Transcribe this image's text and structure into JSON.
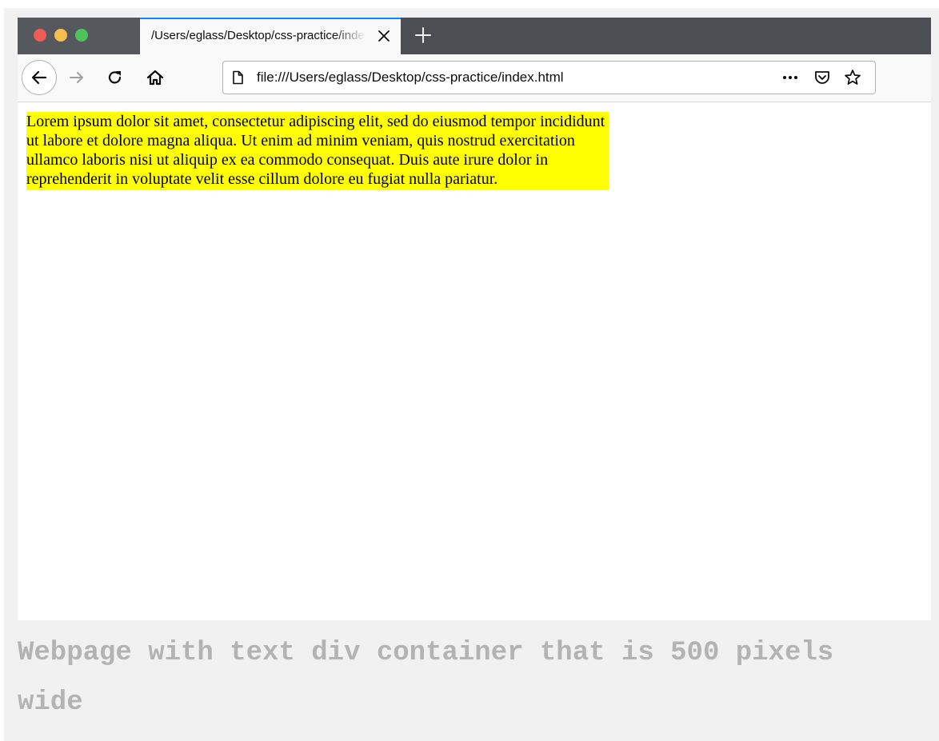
{
  "tab": {
    "title": "/Users/eglass/Desktop/css-practice/index.html"
  },
  "urlbar": {
    "url": "file:///Users/eglass/Desktop/css-practice/index.html"
  },
  "content": {
    "paragraph": "Lorem ipsum dolor sit amet, consectetur adipiscing elit, sed do eiusmod tempor incididunt ut labore et dolore magna aliqua. Ut enim ad minim veniam, quis nostrud exercitation ullamco laboris nisi ut aliquip ex ea commodo consequat. Duis aute irure dolor in reprehenderit in voluptate velit esse cillum dolore eu fugiat nulla pariatur.",
    "highlight_color": "#ffff00"
  },
  "caption": "Webpage with text div container that is 500 pixels wide",
  "icons": {
    "window_controls": [
      "close-light",
      "minimize-light",
      "zoom-light"
    ],
    "tab": [
      "close-icon"
    ],
    "tabstrip": [
      "plus-icon"
    ],
    "navigation": [
      "back-arrow-icon",
      "forward-arrow-icon",
      "reload-icon",
      "home-icon"
    ],
    "urlbar": [
      "page-icon",
      "more-icon",
      "pocket-icon",
      "star-icon"
    ]
  },
  "colors": {
    "tab_accent": "#0a84ff",
    "tabstrip": "#4b4e53",
    "toolbar": "#f9f9fa",
    "traffic_red": "#ee5c55",
    "traffic_yellow": "#f4bf4f",
    "traffic_green": "#4fc35a"
  }
}
